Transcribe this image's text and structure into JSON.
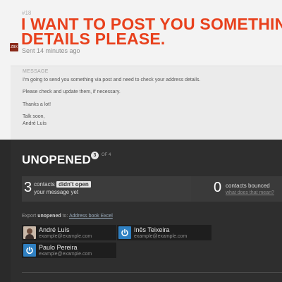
{
  "message": {
    "number": "#18",
    "title_lines": [
      "I WANT TO POST YOU SOMETHING, CH",
      "DETAILS PLEASE."
    ],
    "sent": "Sent 14 minutes ago",
    "avatar_text": "ZBX",
    "label": "MESSAGE",
    "body": [
      "I'm going to send you something via post and need to check your address details.",
      "Please check and update them, if necessary.",
      "Thanks a lot!",
      "Talk soon,",
      "André Luís"
    ]
  },
  "unopened": {
    "heading": "UNOPENED",
    "count": "3",
    "of_total": "OF 4",
    "not_opened": {
      "number": "3",
      "text_before": "contacts",
      "tag": "didn't open",
      "text_after": "your message yet"
    },
    "bounced": {
      "number": "0",
      "text": "contacts bounced",
      "link": "what does that mean?"
    },
    "export": {
      "prefix": "Export",
      "bold": "unopened",
      "to": "to:",
      "link": "Address book Excel"
    },
    "contacts": [
      {
        "name": "André Luís",
        "email": "example@example.com",
        "avatar": "photo"
      },
      {
        "name": "Inês Teixeira",
        "email": "example@example.com",
        "avatar": "power-icon"
      },
      {
        "name": "Paulo Pereira",
        "email": "example@example.com",
        "avatar": "power-icon"
      }
    ]
  },
  "colors": {
    "title": "#e8401c",
    "dark_bg": "#2a2a2a",
    "avatar_blue": "#2f80c2"
  }
}
